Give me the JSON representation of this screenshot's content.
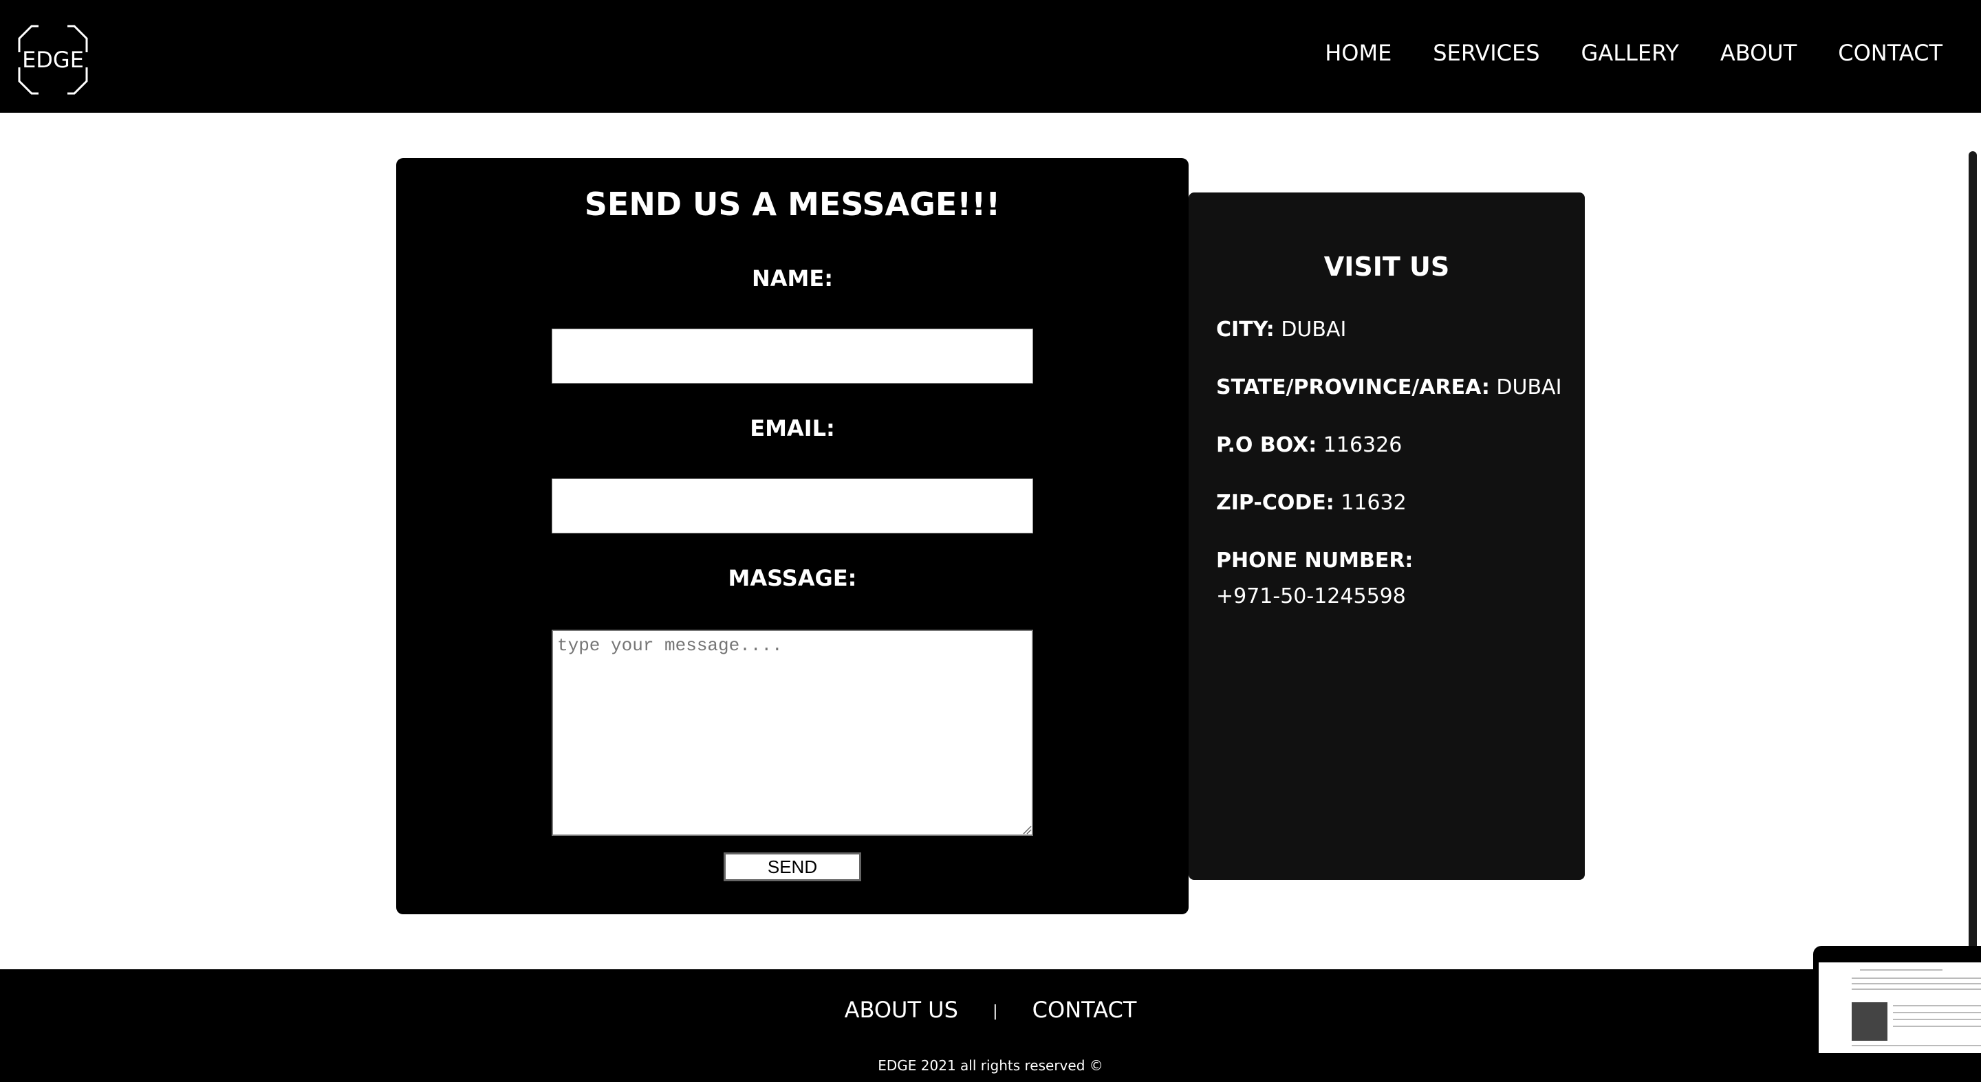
{
  "header": {
    "logo_text": "EDGE",
    "nav": [
      "HOME",
      "SERVICES",
      "GALLERY",
      "ABOUT",
      "CONTACT"
    ]
  },
  "form": {
    "title": "SEND US A MESSAGE!!!",
    "name_label": "NAME:",
    "email_label": "EMAIL:",
    "message_label": "MASSAGE:",
    "message_placeholder": "type your message....",
    "send_label": "SEND"
  },
  "visit": {
    "title": "VISIT US",
    "city_label": "CITY:",
    "city_value": "DUBAI",
    "state_label": "STATE/PROVINCE/AREA:",
    "state_value": "DUBAI",
    "pobox_label": "P.O BOX:",
    "pobox_value": "116326",
    "zip_label": "ZIP-CODE:",
    "zip_value": "11632",
    "phone_label": "PHONE NUMBER:",
    "phone_value": "+971-50-1245598"
  },
  "footer": {
    "about_label": "ABOUT US",
    "separator": "|",
    "contact_label": "CONTACT",
    "copyright": "EDGE 2021 all rights reserved ©"
  },
  "colors": {
    "header_bg": "#000000",
    "form_bg": "#000000",
    "visit_bg": "#111111",
    "page_bg": "#ffffff"
  }
}
